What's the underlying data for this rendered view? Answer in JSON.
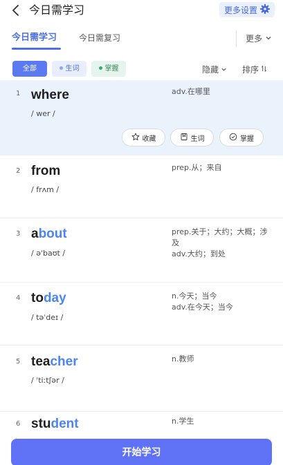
{
  "header": {
    "title": "今日需学习",
    "settings_label": "更多设置"
  },
  "tabs": {
    "study": "今日需学习",
    "review": "今日需复习",
    "more": "更多"
  },
  "filters": {
    "all": "全部",
    "new": "生词",
    "mastered": "掌握",
    "hide": "隐藏",
    "sort": "排序"
  },
  "words": [
    {
      "index": "1",
      "word_a": "where",
      "word_b": "",
      "phonetic": "/ wer /",
      "meaning": "adv.在哪里"
    },
    {
      "index": "2",
      "word_a": "from",
      "word_b": "",
      "phonetic": "/ frʌm /",
      "meaning": "prep.从；来自"
    },
    {
      "index": "3",
      "word_a": "a",
      "word_b": "bout",
      "phonetic": "/ əˈbaʊt /",
      "meaning": "prep.关于；大约；大概；涉及",
      "meaning2": "adv.大约；到处"
    },
    {
      "index": "4",
      "word_a": "to",
      "word_b": "day",
      "phonetic": "/ təˈdeɪ /",
      "meaning": "n.今天；当今",
      "meaning2": "adv.在今天；当今"
    },
    {
      "index": "5",
      "word_a": "tea",
      "word_b": "cher",
      "phonetic": "/ ˈtiːtʃər /",
      "meaning": "n.教师"
    },
    {
      "index": "6",
      "word_a": "stu",
      "word_b": "dent",
      "phonetic": "",
      "meaning": "n.学生"
    }
  ],
  "actions": {
    "favorite": "收藏",
    "new_word": "生词",
    "master": "掌握"
  },
  "start_button": "开始学习",
  "colors": {
    "accent": "#4b6fe6",
    "highlight": "#4b86f0",
    "selected_row": "#eaf2fc",
    "start_button": "#5f72f5"
  }
}
